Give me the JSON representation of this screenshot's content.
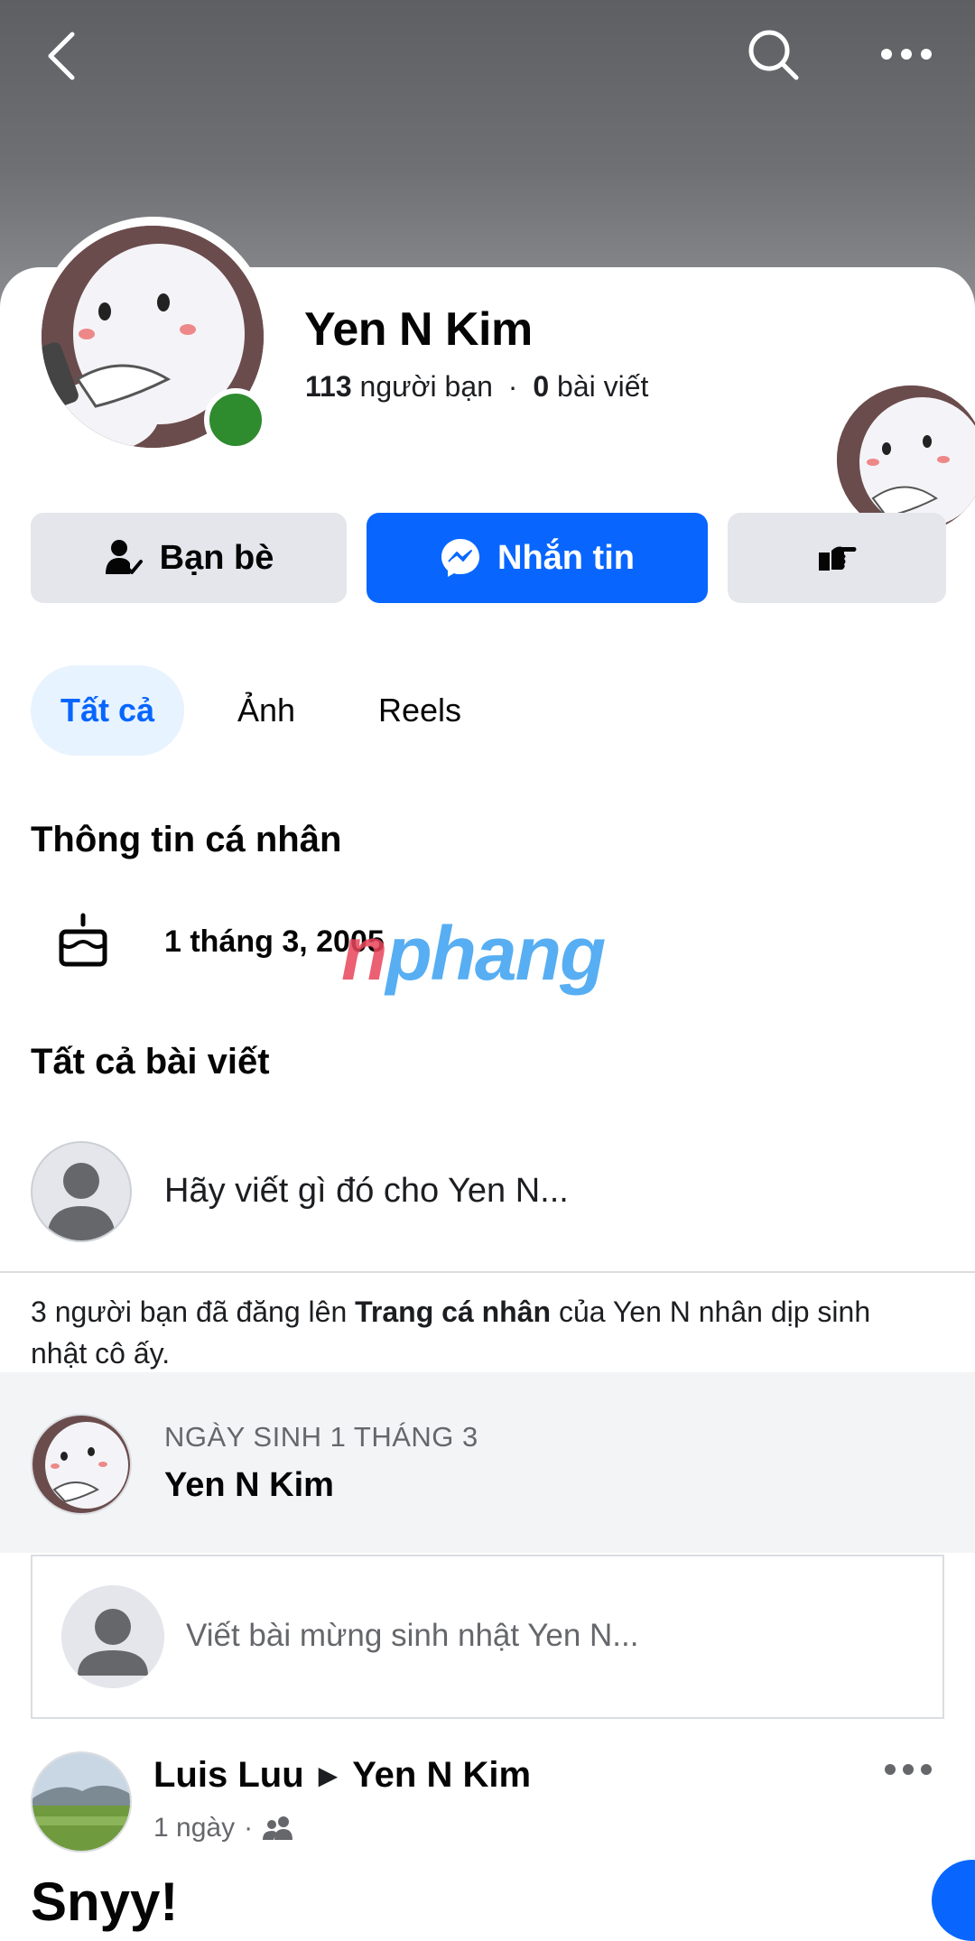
{
  "profile": {
    "name": "Yen N Kim",
    "friends_count": "113",
    "friends_label": "người bạn",
    "separator": "·",
    "posts_count": "0",
    "posts_label": "bài viết"
  },
  "actions": {
    "friends_label": "Bạn bè",
    "message_label": "Nhắn tin"
  },
  "tabs": [
    {
      "label": "Tất cả",
      "active": true
    },
    {
      "label": "Ảnh",
      "active": false
    },
    {
      "label": "Reels",
      "active": false
    }
  ],
  "personal_info": {
    "title": "Thông tin cá nhân",
    "birthday": "1 tháng 3, 2005"
  },
  "watermark": {
    "first": "n",
    "rest": "phang"
  },
  "all_posts": {
    "title": "Tất cả bài viết",
    "compose_placeholder": "Hãy viết gì đó cho Yen N..."
  },
  "notice": {
    "part1": "3 người bạn đã đăng lên ",
    "bold": "Trang cá nhân",
    "part2": " của Yen N nhân dịp sinh nhật cô ấy."
  },
  "birthday_card": {
    "label": "NGÀY SINH 1 THÁNG 3",
    "name": "Yen N Kim",
    "wish_placeholder": "Viết bài mừng sinh nhật Yen N..."
  },
  "post": {
    "author": "Luis Luu",
    "arrow": "▶",
    "target": "Yen N Kim",
    "time": "1 ngày",
    "dot": "·",
    "title": "Snyy!"
  },
  "colors": {
    "accent": "#0866ff",
    "online": "#2e8b2e",
    "tab_active_bg": "#e7f3ff"
  },
  "icons": [
    "back-icon",
    "search-icon",
    "more-icon",
    "friends-check-icon",
    "messenger-icon",
    "hand-point-icon",
    "birthday-cake-icon",
    "person-icon",
    "friends-audience-icon"
  ]
}
